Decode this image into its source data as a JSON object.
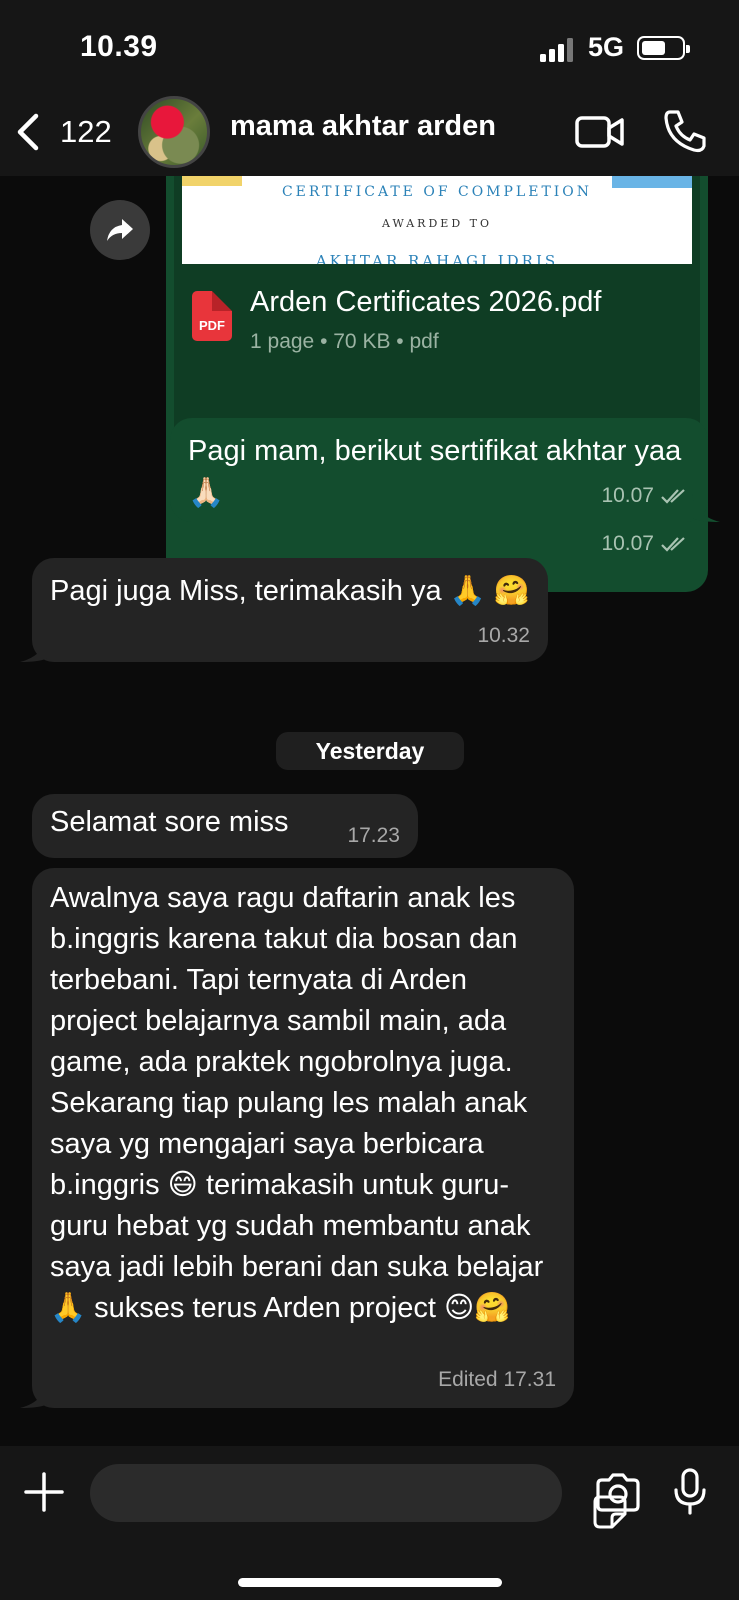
{
  "status_bar": {
    "time": "10.39",
    "network": "5G",
    "battery_level": 0.6
  },
  "header": {
    "back_count": "122",
    "contact_name": "mama akhtar arden",
    "icons": [
      "chevron-left-icon",
      "video-call-icon",
      "phone-call-icon"
    ]
  },
  "messages": [
    {
      "direction": "outgoing",
      "type": "document",
      "preview": {
        "title": "CERTIFICATE OF COMPLETION",
        "subtitle": "AWARDED TO",
        "name": "AKHTAR RAHAGI IDRIS"
      },
      "file_name": "Arden Certificates 2026.pdf",
      "file_meta": "1 page • 70 KB • pdf",
      "file_icon_label": "PDF",
      "time": "10.07"
    },
    {
      "direction": "outgoing",
      "text": "Pagi mam, berikut sertifikat akhtar yaa 🙏🏻",
      "time": "10.07"
    },
    {
      "direction": "incoming",
      "text": "Pagi juga Miss, terimakasih ya 🙏 🤗",
      "time": "10.32"
    },
    {
      "direction": "incoming",
      "text": "Selamat sore miss",
      "time": "17.23"
    },
    {
      "direction": "incoming",
      "text": "Awalnya saya ragu daftarin anak les b.inggris karena takut dia bosan dan terbebani. Tapi ternyata di Arden project belajarnya sambil main, ada game, ada praktek ngobrolnya juga. Sekarang tiap pulang les malah anak saya yg mengajari saya berbicara b.inggris 😄 terimakasih untuk guru-guru hebat yg sudah membantu anak saya jadi lebih berani dan suka belajar 🙏 sukses terus Arden project 😊🤗",
      "time": "Edited 17.31"
    }
  ],
  "date_separator": "Yesterday",
  "composer": {
    "placeholder": "",
    "icons": [
      "plus-icon",
      "sticker-icon",
      "camera-icon",
      "microphone-icon"
    ]
  }
}
